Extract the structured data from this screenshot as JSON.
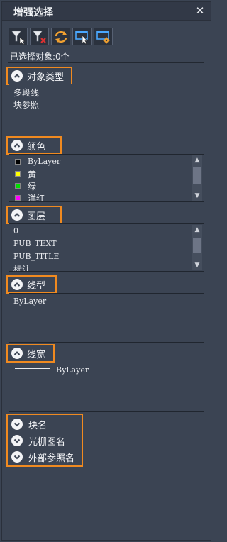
{
  "window": {
    "title": "增强选择",
    "close_glyph": "✕"
  },
  "toolbar": {
    "buttons": [
      {
        "name": "filter-add-icon"
      },
      {
        "name": "filter-remove-icon"
      },
      {
        "name": "refresh-icon"
      },
      {
        "name": "select-cursor-icon"
      },
      {
        "name": "select-settings-icon"
      }
    ]
  },
  "status": {
    "selected_text": "已选择对象:0个"
  },
  "sections": {
    "object_type": {
      "label": "对象类型",
      "items": [
        "多段线",
        "块参照"
      ]
    },
    "color": {
      "label": "颜色",
      "items": [
        {
          "label": "ByLayer",
          "color": "#000000"
        },
        {
          "label": "黄",
          "color": "#ffff00"
        },
        {
          "label": "绿",
          "color": "#00e000"
        },
        {
          "label": "洋红",
          "color": "#ff00ff"
        }
      ]
    },
    "layer": {
      "label": "图层",
      "items": [
        "0",
        "PUB_TEXT",
        "PUB_TITLE",
        "标注"
      ]
    },
    "linetype": {
      "label": "线型",
      "items": [
        "ByLayer"
      ]
    },
    "lineweight": {
      "label": "线宽",
      "items": [
        "ByLayer"
      ]
    },
    "collapsed": [
      "块名",
      "光栅图名",
      "外部参照名"
    ]
  },
  "colors": {
    "highlight_border": "#f08a20",
    "background": "#3b4453"
  }
}
